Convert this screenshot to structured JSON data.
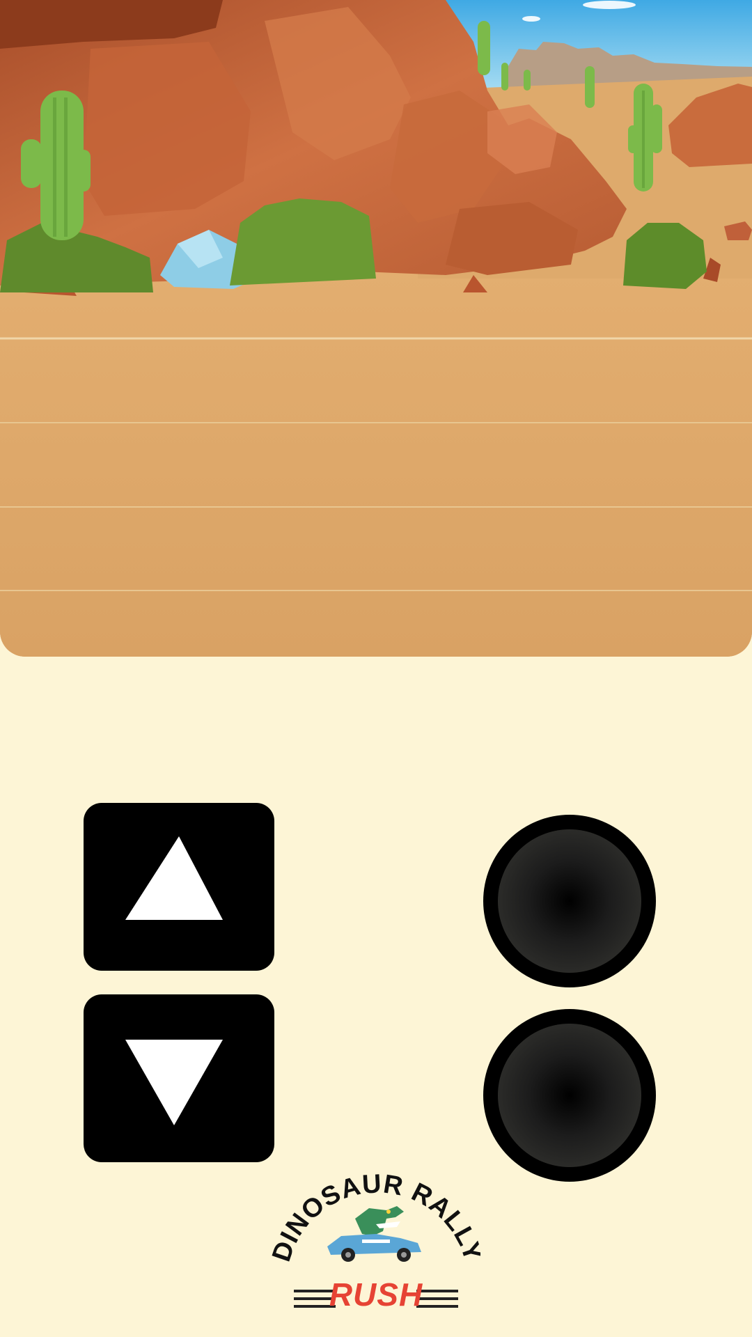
{
  "scene": {
    "description_icons": [
      "desert-scene"
    ],
    "colors": {
      "sky": "#5fbde8",
      "rock": "#c86a3c",
      "sand": "#dca666",
      "cactus": "#7cba4a",
      "background": "#fdf5d6"
    }
  },
  "controls": {
    "up_icon": "triangle-up-icon",
    "down_icon": "triangle-down-icon",
    "action_buttons": [
      "round-button",
      "round-button"
    ]
  },
  "logo": {
    "title": "DINOSAUR RALLY",
    "subtitle": "RUSH",
    "title_color": "#111111",
    "subtitle_color": "#e64334"
  }
}
